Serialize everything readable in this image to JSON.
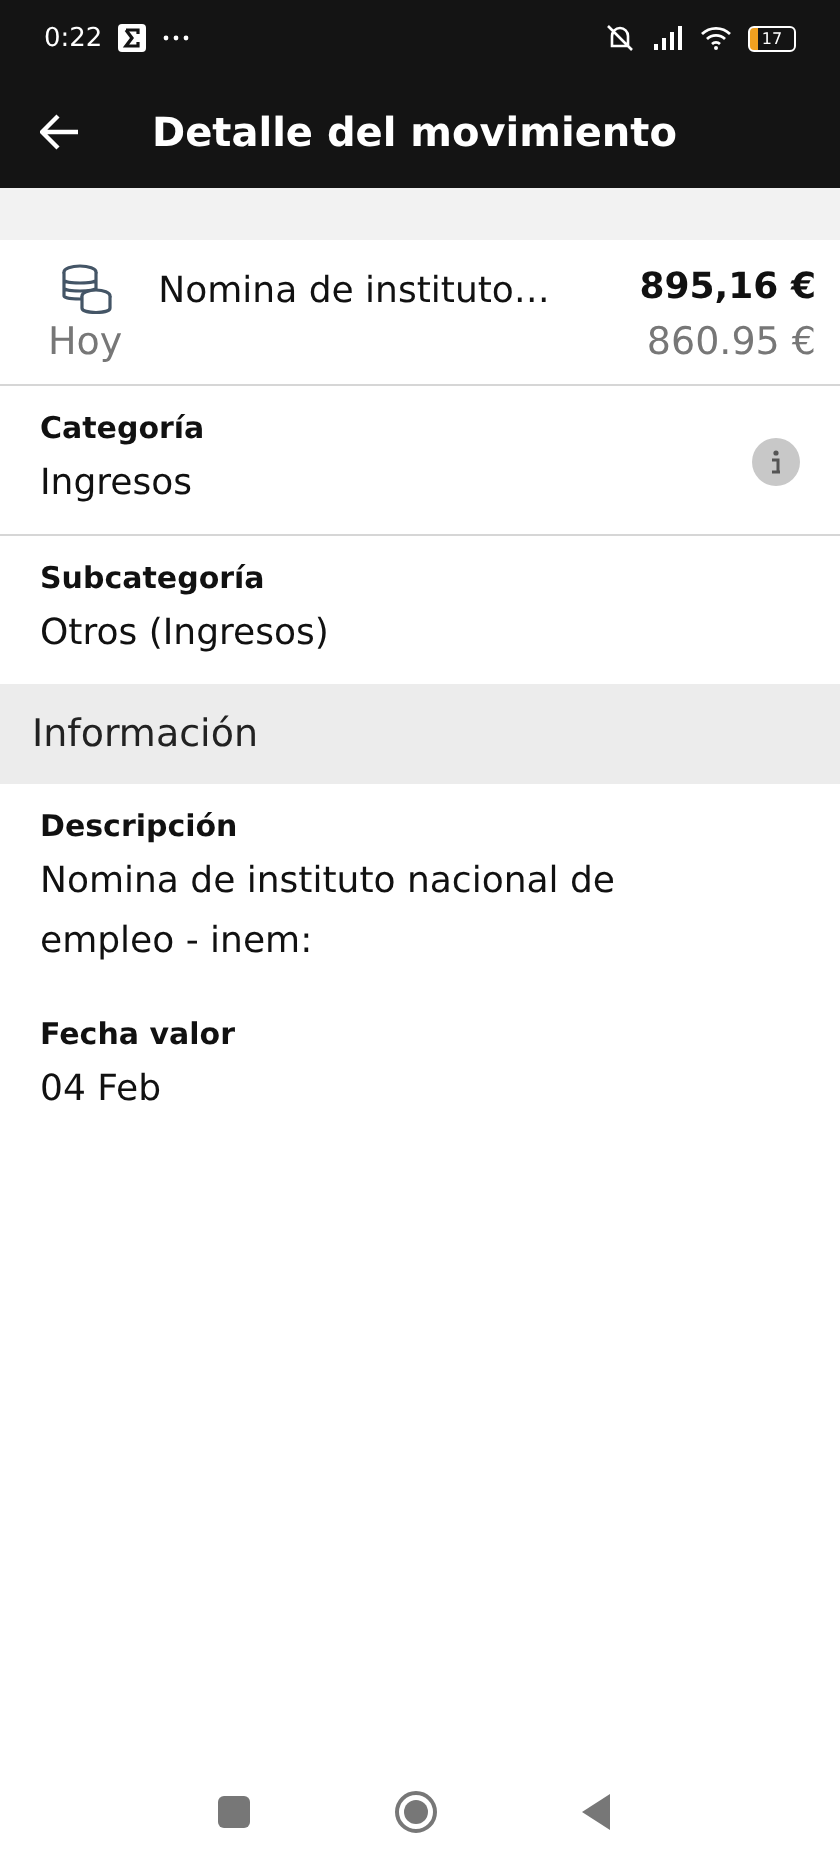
{
  "status_bar": {
    "time": "0:22",
    "battery": "17"
  },
  "header": {
    "title": "Detalle del movimiento"
  },
  "transaction": {
    "date": "Hoy",
    "name": "Nomina de instituto…",
    "amount": "895,16 €",
    "balance": "860.95 €"
  },
  "fields": [
    {
      "label": "Categoría",
      "value": "Ingresos",
      "info": true
    },
    {
      "label": "Subcategoría",
      "value": "Otros (Ingresos)"
    }
  ],
  "section": {
    "title": "Información"
  },
  "details": [
    {
      "label": "Descripción",
      "value": "Nomina de instituto nacional de empleo - inem:"
    },
    {
      "label": "Fecha valor",
      "value": "04 Feb"
    }
  ]
}
